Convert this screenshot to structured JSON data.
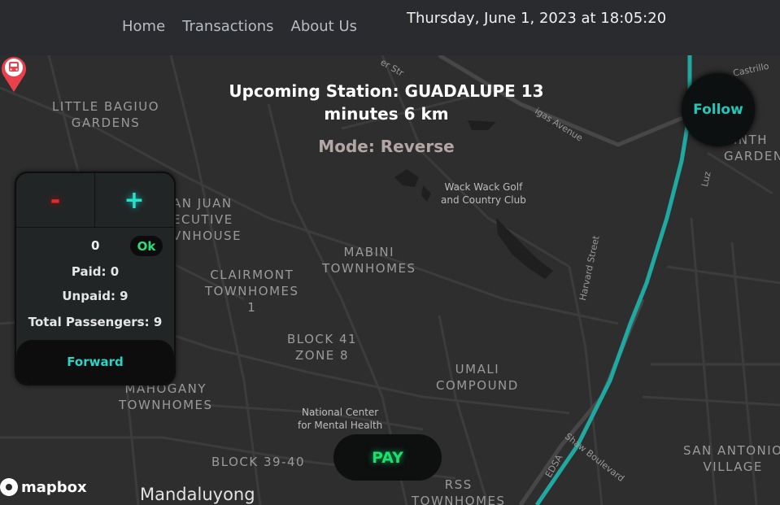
{
  "nav": {
    "home": "Home",
    "transactions": "Transactions",
    "about": "About Us"
  },
  "datetime": "Thursday, June 1, 2023 at 18:05:20",
  "station": {
    "line1": "Upcoming Station: GUADALUPE 13",
    "line2": "minutes 6 km"
  },
  "mode": "Mode: Reverse",
  "follow_label": "Follow",
  "panel": {
    "minus": "-",
    "plus": "+",
    "count": "0",
    "ok_label": "Ok",
    "paid": "Paid: 0",
    "unpaid": "Unpaid: 9",
    "total": "Total Passengers: 9",
    "forward_label": "Forward"
  },
  "pay_label": "PAY",
  "map": {
    "labels": {
      "little_baguio": "LITTLE BAGIUO\nGARDENS",
      "san_juan": "AN JUAN\nECUTIVE\nVNHOUSE",
      "clairmont": "CLAIRMONT\nTOWNHOMES\n1",
      "mabini": "MABINI\nTOWNHOMES",
      "block41": "BLOCK 41\nZONE 8",
      "umali": "UMALI\nCOMPOUND",
      "mahogany": "MAHOGANY\nTOWNHOMES",
      "block39": "BLOCK 39-40",
      "rss": "RSS\nTOWNHOMES",
      "san_antonio": "SAN ANTONIO\nVILLAGE",
      "corinthian": "RINTH\nGARDEN",
      "wack_wack": "Wack Wack Golf\nand Country Club",
      "ncmh": "National Center\nfor Mental Health",
      "city": "Mandaluyong"
    },
    "streets": {
      "harvard": "Harvard Street",
      "shaw": "Shaw Boulevard",
      "gigas": "igas Avenue",
      "castrillo": "Castrillo",
      "luz": "Luz",
      "edsa": "EDSA",
      "str": "er Str"
    },
    "attribution": "mapbox"
  },
  "colors": {
    "route": "#1fa9a1",
    "marker": "#e8414b",
    "accent": "#22c7b8",
    "pay": "#1be06a"
  }
}
